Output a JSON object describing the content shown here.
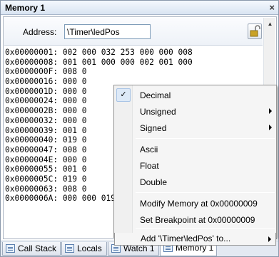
{
  "window": {
    "title": "Memory 1",
    "close_glyph": "×"
  },
  "address": {
    "label": "Address:",
    "value": "\\Timer\\ledPos"
  },
  "lock_icon": "unlock-icon",
  "memory": {
    "lines": [
      "0x00000001: 002 000 032 253 000 000 008",
      "0x00000008: 001 001 000 000 002 001 000",
      "0x0000000F: 008 0",
      "0x00000016: 000 0",
      "0x0000001D: 000 0",
      "0x00000024: 000 0",
      "0x0000002B: 000 0",
      "0x00000032: 000 0",
      "0x00000039: 001 0",
      "0x00000040: 019 0",
      "0x00000047: 008 0",
      "0x0000004E: 000 0",
      "0x00000055: 001 0",
      "0x0000005C: 019 0",
      "0x00000063: 008 0",
      "0x0000006A: 000 000 019 001 000 000 019"
    ]
  },
  "context_menu": {
    "items": [
      {
        "label": "Decimal",
        "checked": true,
        "submenu": false
      },
      {
        "label": "Unsigned",
        "checked": false,
        "submenu": true
      },
      {
        "label": "Signed",
        "checked": false,
        "submenu": true
      },
      {
        "label": "Ascii",
        "checked": false,
        "submenu": false
      },
      {
        "label": "Float",
        "checked": false,
        "submenu": false
      },
      {
        "label": "Double",
        "checked": false,
        "submenu": false
      },
      {
        "label": "Modify Memory at 0x00000009",
        "checked": false,
        "submenu": false
      },
      {
        "label": "Set Breakpoint at 0x00000009",
        "checked": false,
        "submenu": false
      },
      {
        "label": "Add '\\Timer\\ledPos' to...",
        "checked": false,
        "submenu": true
      }
    ],
    "check_glyph": "✓"
  },
  "tabs": [
    {
      "label": "Call Stack",
      "icon": "call-stack-icon",
      "active": false
    },
    {
      "label": "Locals",
      "icon": "locals-icon",
      "active": false
    },
    {
      "label": "Watch 1",
      "icon": "watch-icon",
      "active": false
    },
    {
      "label": "Memory 1",
      "icon": "memory-icon",
      "active": true
    }
  ],
  "colors": {
    "title_bar": "#d9e4f2",
    "selection_border": "#a8c4e6",
    "menu_bg": "#f5f5f5"
  }
}
